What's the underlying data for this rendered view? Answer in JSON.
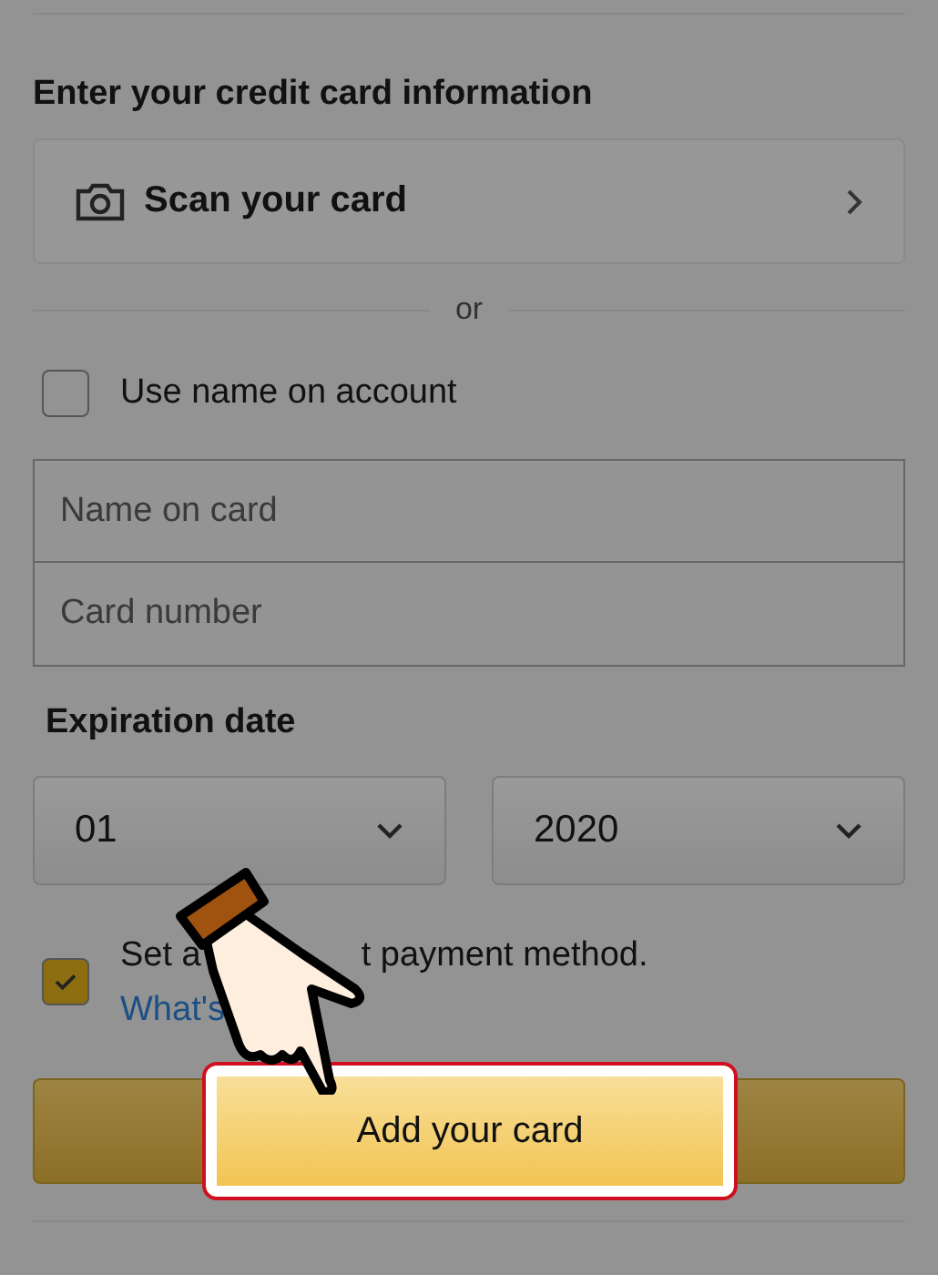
{
  "heading": "Enter your credit card information",
  "scan": {
    "label": "Scan your card"
  },
  "separator": "or",
  "use_name": {
    "label": "Use name on account",
    "checked": false
  },
  "fields": [
    {
      "placeholder": "Name on card"
    },
    {
      "placeholder": "Card number"
    }
  ],
  "expiration": {
    "label": "Expiration date",
    "month": "01",
    "year": "2020"
  },
  "default_option": {
    "checked": true,
    "label_parts": [
      "Set a",
      "t payment method."
    ],
    "link": "What's"
  },
  "submit": {
    "label": "Add your card",
    "highlighted": true
  }
}
